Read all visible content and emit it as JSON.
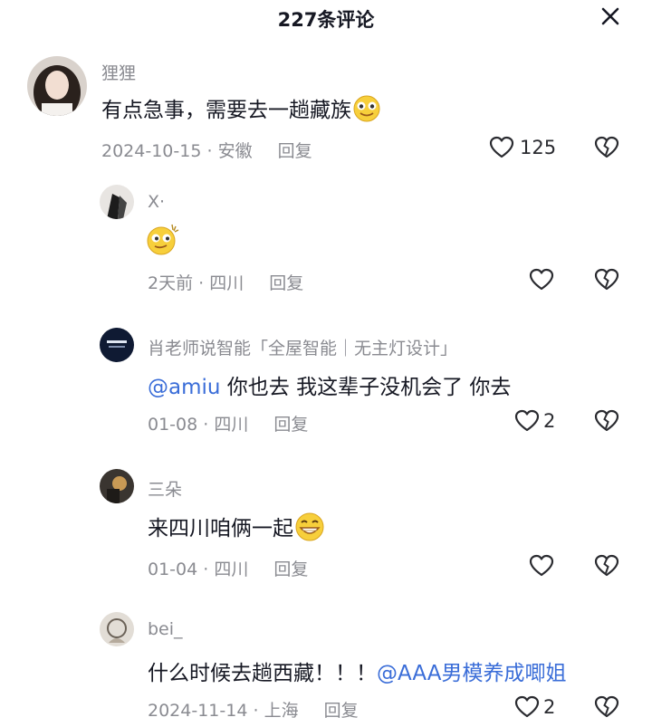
{
  "header": {
    "title": "227条评论",
    "close_icon": "close-icon"
  },
  "comments": [
    {
      "username": "狸狸",
      "text": "有点急事，需要去一趟藏族",
      "emoji": "smiling-face-emoji",
      "date": "2024-10-15",
      "location": "安徽",
      "reply_label": "回复",
      "likes": "125"
    },
    {
      "username": "X·",
      "text": "",
      "emoji": "smirking-face-emoji",
      "date": "2天前",
      "location": "四川",
      "reply_label": "回复",
      "likes": ""
    },
    {
      "username": "肖老师说智能「全屋智能｜无主灯设计」",
      "mention": "@amiu",
      "text": " 你也去 我这辈子没机会了 你去",
      "date": "01-08",
      "location": "四川",
      "reply_label": "回复",
      "likes": "2"
    },
    {
      "username": "三朵",
      "text": "来四川咱俩一起",
      "emoji": "grinning-face-emoji",
      "date": "01-04",
      "location": "四川",
      "reply_label": "回复",
      "likes": ""
    },
    {
      "username": "bei_",
      "text": "什么时候去趟西藏！！！",
      "mention": "@AAA男模养成唧姐",
      "date": "2024-11-14",
      "location": "上海",
      "reply_label": "回复",
      "likes": "2"
    }
  ],
  "separator": "·",
  "colors": {
    "text": "#161823",
    "muted": "#8a8b91",
    "mention": "#3a6dd8",
    "background": "#ffffff"
  }
}
